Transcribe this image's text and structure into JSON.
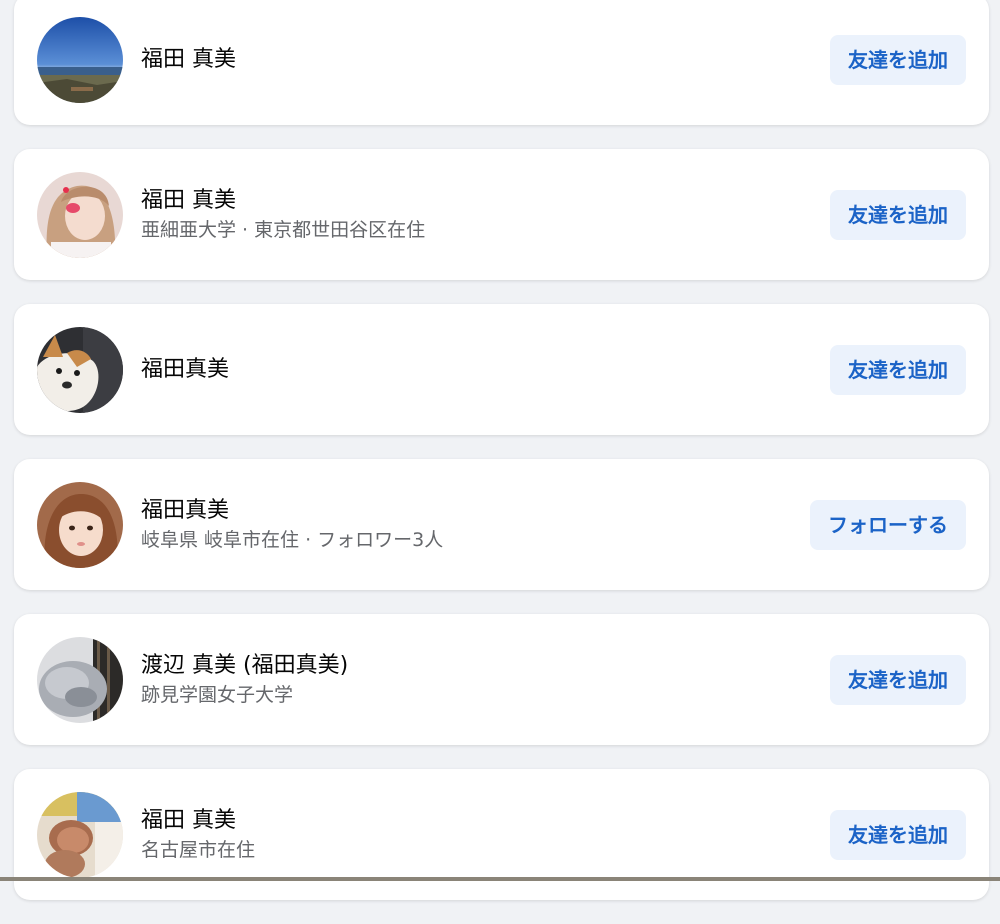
{
  "results": [
    {
      "name": "福田 真美",
      "subtitle": "",
      "action_label": "友達を追加",
      "avatar_icon": "landscape-photo"
    },
    {
      "name": "福田 真美",
      "subtitle": "亜細亜大学 · 東京都世田谷区在住",
      "action_label": "友達を追加",
      "avatar_icon": "person-photo"
    },
    {
      "name": "福田真美",
      "subtitle": "",
      "action_label": "友達を追加",
      "avatar_icon": "dog-photo"
    },
    {
      "name": "福田真美",
      "subtitle": "岐阜県 岐阜市在住 · フォロワー3人",
      "action_label": "フォローする",
      "avatar_icon": "person-photo"
    },
    {
      "name": "渡辺 真美 (福田真美)",
      "subtitle": "跡見学園女子大学",
      "action_label": "友達を追加",
      "avatar_icon": "animal-photo"
    },
    {
      "name": "福田 真美",
      "subtitle": "名古屋市在住",
      "action_label": "友達を追加",
      "avatar_icon": "baby-photo"
    }
  ],
  "colors": {
    "action_text": "#1b63c7",
    "action_bg": "#ebf2fc",
    "card_bg": "#ffffff",
    "page_bg": "#f0f2f5"
  }
}
